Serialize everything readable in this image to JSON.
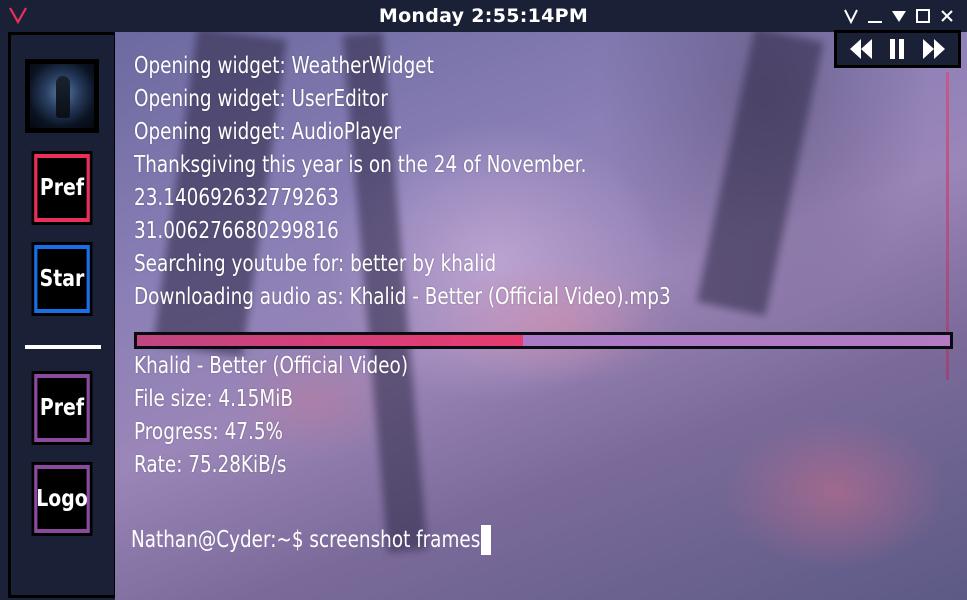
{
  "titlebar": {
    "clock": "Monday 2:55:14PM",
    "logo_icon": "v-logo-icon",
    "controls": [
      "collapse-v-icon",
      "minimize-icon",
      "dropdown-triangle-icon",
      "maximize-icon",
      "close-icon"
    ],
    "accent": "#e8305a"
  },
  "sidebar": {
    "avatar_icon": "space-figure-avatar",
    "buttons": [
      {
        "label": "Pref",
        "border": "#e8305a"
      },
      {
        "label": "Star",
        "border": "#1a6ee8"
      },
      {
        "label": "Pref",
        "border": "#8a4a9e"
      },
      {
        "label": "Logo",
        "border": "#8a4a9e"
      }
    ]
  },
  "terminal": {
    "lines": [
      "Opening widget: WeatherWidget",
      "Opening widget: UserEditor",
      "Opening widget: AudioPlayer",
      "Thanksgiving this year is on the 24 of November.",
      "23.140692632779263",
      "31.006276680299816",
      "Searching youtube for: better by khalid",
      "Downloading audio as: Khalid - Better (Official Video).mp3"
    ],
    "download_progress": 47.5,
    "media": [
      "Khalid - Better (Official Video)",
      "File size: 4.15MiB",
      "Progress: 47.5%",
      "Rate: 75.28KiB/s"
    ],
    "prompt": "Nathan@Cyder:~$ screenshot frames"
  },
  "media_controls": {
    "icons": [
      "rewind-icon",
      "pause-icon",
      "fast-forward-icon"
    ]
  }
}
